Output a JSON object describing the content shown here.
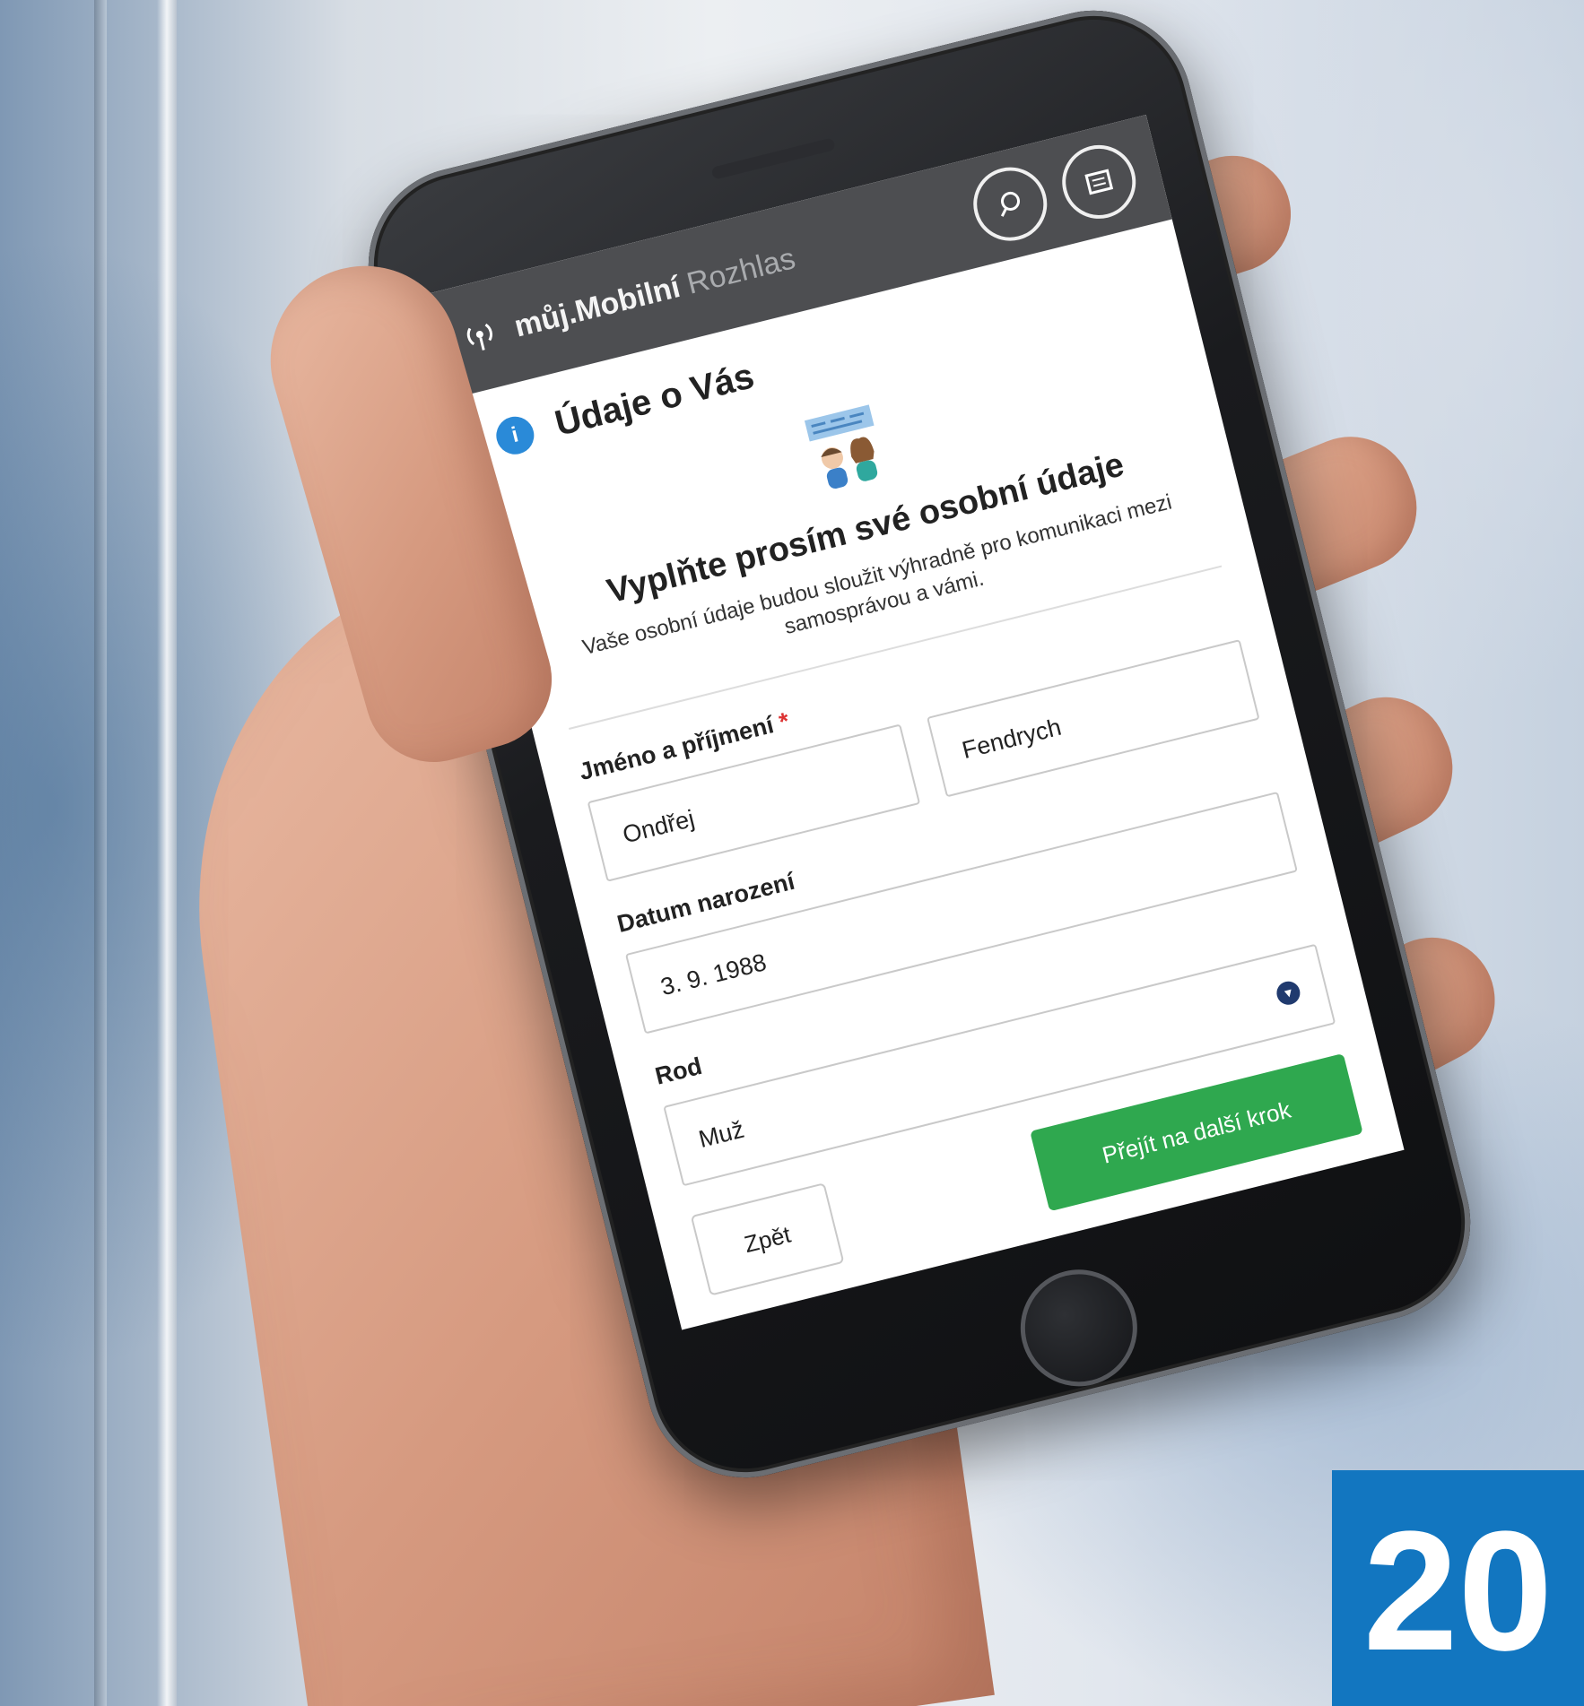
{
  "app": {
    "brand_bold": "můj.Mobilní",
    "brand_light": "Rozhlas"
  },
  "header": {
    "icons": [
      "radio-antenna-icon",
      "search-icon",
      "menu-icon"
    ]
  },
  "section": {
    "title": "Údaje o Vás",
    "icon": "user-icon"
  },
  "intro": {
    "title": "Vyplňte prosím své osobní údaje",
    "text": "Vaše osobní údaje budou sloužit výhradně pro komunikaci mezi samosprávou a vámi."
  },
  "form": {
    "name_label": "Jméno a příjmení",
    "required_mark": "*",
    "first_name": "Ondřej",
    "last_name": "Fendrych",
    "birth_label": "Datum narození",
    "birth_value": "3. 9. 1988",
    "gender_label": "Rod",
    "gender_value": "Muž"
  },
  "buttons": {
    "back": "Zpět",
    "next": "Přejít na další krok"
  },
  "page_number": "20",
  "colors": {
    "header_bg": "#4d4e51",
    "accent_blue": "#2a8ad8",
    "next_button": "#2fa84f",
    "badge": "#1276c0"
  }
}
